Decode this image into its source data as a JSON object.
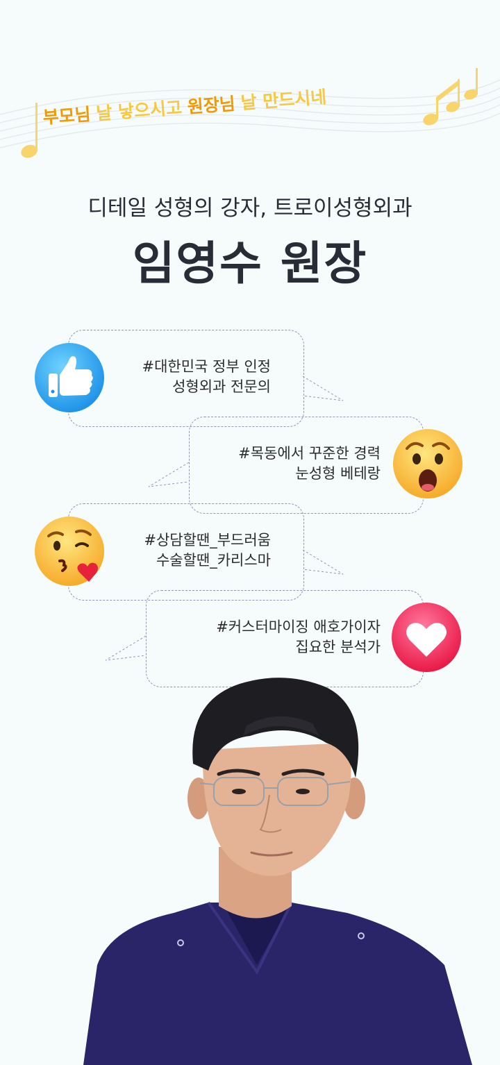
{
  "banner": {
    "parts": [
      {
        "text": "부모님",
        "style": "highlight"
      },
      {
        "text": "날 낳으시고",
        "style": "plain"
      },
      {
        "text": "원장님",
        "style": "highlight"
      },
      {
        "text": "날 만드시네",
        "style": "plain"
      }
    ]
  },
  "header": {
    "subtitle": "디테일 성형의 강자, 트로이성형외과",
    "title": "임영수 원장"
  },
  "bubbles": [
    {
      "line1": "#대한민국 정부 인정",
      "line2": "성형외과 전문의",
      "emoji": "thumbs-up-icon"
    },
    {
      "line1": "#목동에서 꾸준한 경력",
      "line2": "눈성형 베테랑",
      "emoji": "surprised-face-icon"
    },
    {
      "line1": "#상담할땐_부드러움",
      "line2": "수술할땐_카리스마",
      "emoji": "kissing-face-icon"
    },
    {
      "line1": "#커스터마이징 애호가이자",
      "line2": "집요한 분석가",
      "emoji": "heart-icon"
    }
  ],
  "colors": {
    "highlight": "#f39a00",
    "plain": "#f7c842",
    "text_dark": "#262d36",
    "bubble_border": "#8f97b8"
  }
}
